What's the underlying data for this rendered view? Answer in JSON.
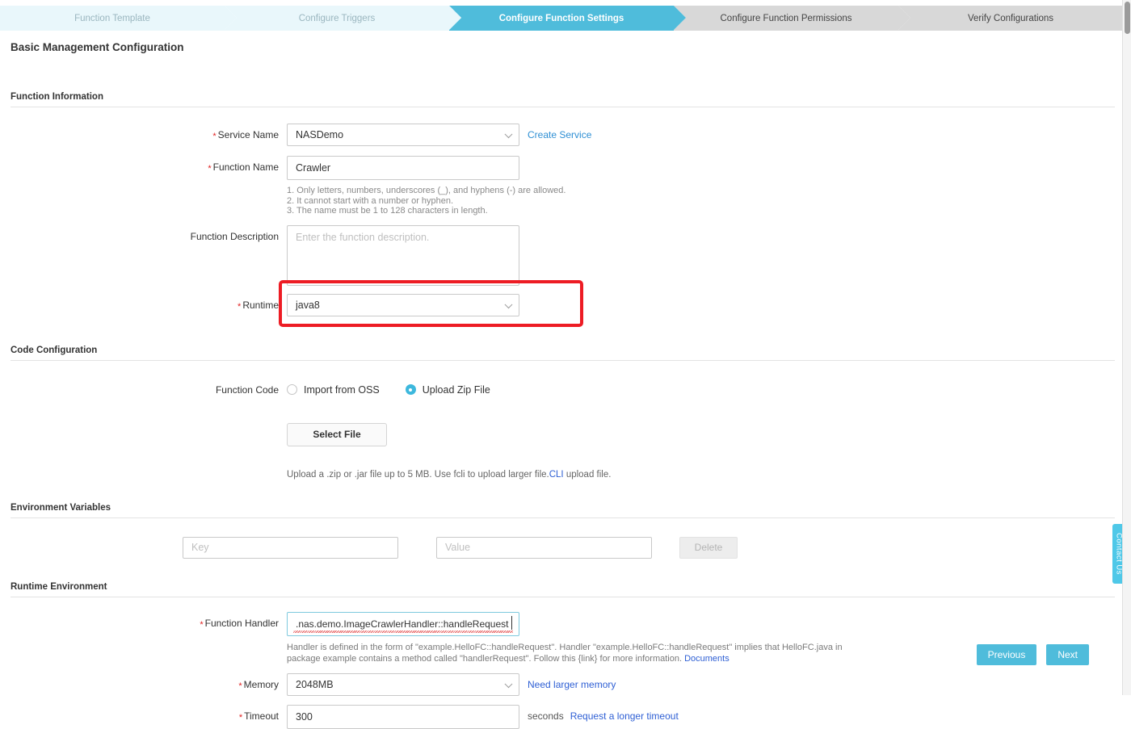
{
  "stepper": {
    "steps": [
      {
        "label": "Function Template",
        "state": "done"
      },
      {
        "label": "Configure Triggers",
        "state": "done"
      },
      {
        "label": "Configure Function Settings",
        "state": "active"
      },
      {
        "label": "Configure Function Permissions",
        "state": "pending"
      },
      {
        "label": "Verify Configurations",
        "state": "pending"
      }
    ]
  },
  "page": {
    "title": "Basic Management Configuration"
  },
  "function_information": {
    "heading": "Function Information",
    "service_name": {
      "label": "Service Name",
      "value": "NASDemo",
      "create_link": "Create Service"
    },
    "function_name": {
      "label": "Function Name",
      "value": "Crawler",
      "hint": "1. Only letters, numbers, underscores (_), and hyphens (-) are allowed.\n2. It cannot start with a number or hyphen.\n3. The name must be 1 to 128 characters in length."
    },
    "function_description": {
      "label": "Function Description",
      "value": "",
      "placeholder": "Enter the function description."
    },
    "runtime": {
      "label": "Runtime",
      "value": "java8",
      "highlighted": true,
      "highlight_color": "#ed1c24"
    }
  },
  "code_configuration": {
    "heading": "Code Configuration",
    "function_code": {
      "label": "Function Code",
      "options": [
        {
          "label": "Import from OSS",
          "selected": false
        },
        {
          "label": "Upload Zip File",
          "selected": true
        }
      ]
    },
    "select_file_button": "Select File",
    "upload_hint_before": "Upload a .zip or .jar file up to 5 MB. Use fcli to upload larger file.",
    "upload_hint_link": "CLI",
    "upload_hint_after": " upload file."
  },
  "environment_variables": {
    "heading": "Environment Variables",
    "key_placeholder": "Key",
    "key_value": "",
    "value_placeholder": "Value",
    "value_value": "",
    "delete_button": "Delete"
  },
  "runtime_environment": {
    "heading": "Runtime Environment",
    "function_handler": {
      "label": "Function Handler",
      "value": ".nas.demo.ImageCrawlerHandler::handleRequest",
      "focused": true,
      "hint": "Handler is defined in the form of \"example.HelloFC::handleRequest\". Handler \"example.HelloFC::handleRequest\" implies that HelloFC.java in package example contains a method called \"handlerRequest\". Follow this {link} for more information. ",
      "hint_link": "Documents"
    },
    "memory": {
      "label": "Memory",
      "value": "2048MB",
      "link": "Need larger memory"
    },
    "timeout": {
      "label": "Timeout",
      "value": "300",
      "unit": "seconds",
      "link": "Request a longer timeout"
    }
  },
  "footer": {
    "previous_button": "Previous",
    "next_button": "Next"
  },
  "widgets": {
    "contact_tab": "Contact Us"
  },
  "colors": {
    "accent": "#4fbcdb",
    "link": "#2e8fd4",
    "required": "#e02020",
    "highlight": "#ed1c24"
  }
}
